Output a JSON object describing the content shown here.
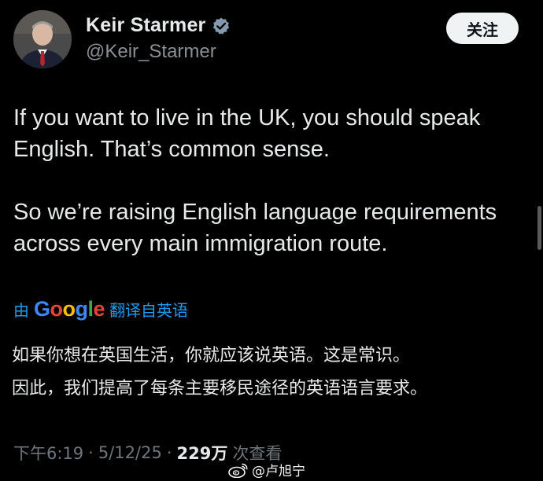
{
  "author": {
    "display_name": "Keir Starmer",
    "handle": "@Keir_Starmer",
    "verified": true
  },
  "follow_button": {
    "label": "关注"
  },
  "tweet": {
    "paragraphs": [
      "If you want to live in the UK, you should speak English. That’s common sense.",
      "So we’re raising English language requirements across every main immigration route."
    ]
  },
  "translation": {
    "prefix": "由",
    "provider": "Google",
    "suffix": "翻译自英语",
    "paragraphs": [
      "如果你想在英国生活，你就应该说英语。这是常识。",
      "因此，我们提高了每条主要移民途径的英语语言要求。"
    ]
  },
  "meta": {
    "time": "下午6:19",
    "date": "5/12/25",
    "views_count": "229万",
    "views_label": "次查看",
    "separator": "·"
  },
  "watermark": {
    "text": "@卢旭宁",
    "icon": "weibo-icon"
  },
  "colors": {
    "background": "#000000",
    "primary_text": "#e7e9ea",
    "secondary_text": "#6e767d",
    "link_blue": "#1d9bf0",
    "follow_bg": "#eff3f4"
  }
}
